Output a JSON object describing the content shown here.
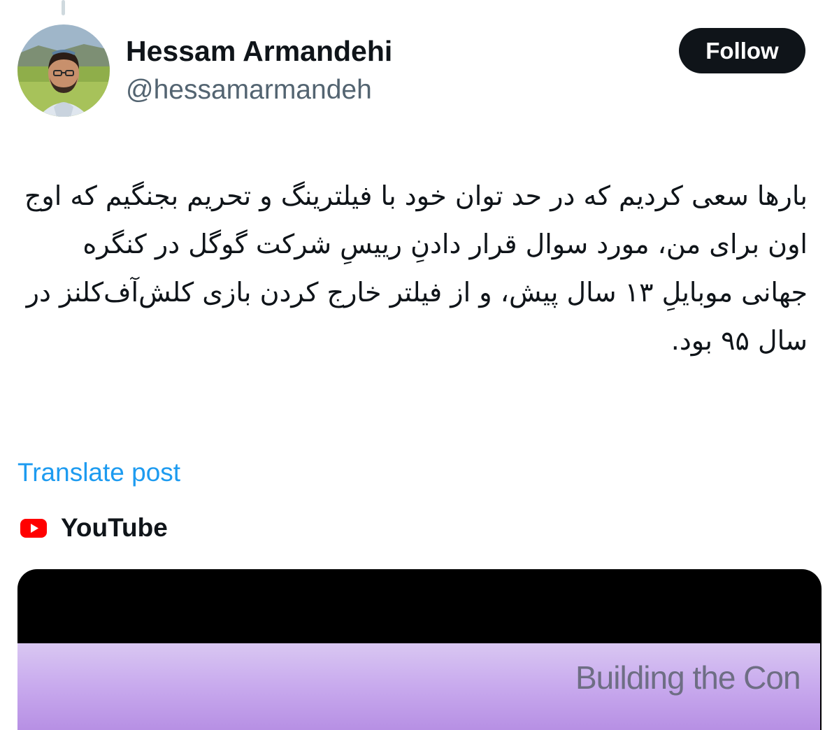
{
  "post": {
    "author": {
      "display_name": "Hessam Armandehi",
      "handle": "@hessamarmandeh",
      "avatar_icon": "user-avatar-photo"
    },
    "follow_label": "Follow",
    "text": "بارها سعی کردیم که در حد توان خود با فیلترینگ و تحریم بجنگیم که اوج اون برای من، مورد سوال قرار دادنِ رییسِ شرکت گوگل در کنگره جهانی موبایلِ ۱۳ سال پیش، و از فیلتر خارج کردن بازی کلش‌آف‌کلنز در سال ۹۵ بود.",
    "translate_label": "Translate post",
    "card": {
      "source_icon": "youtube-icon",
      "source_label": "YouTube",
      "preview_caption": "Building the Con"
    }
  },
  "colors": {
    "follow_button_bg": "#0f1419",
    "link": "#1d9bf0",
    "handle": "#536471",
    "youtube_red": "#ff0000"
  }
}
